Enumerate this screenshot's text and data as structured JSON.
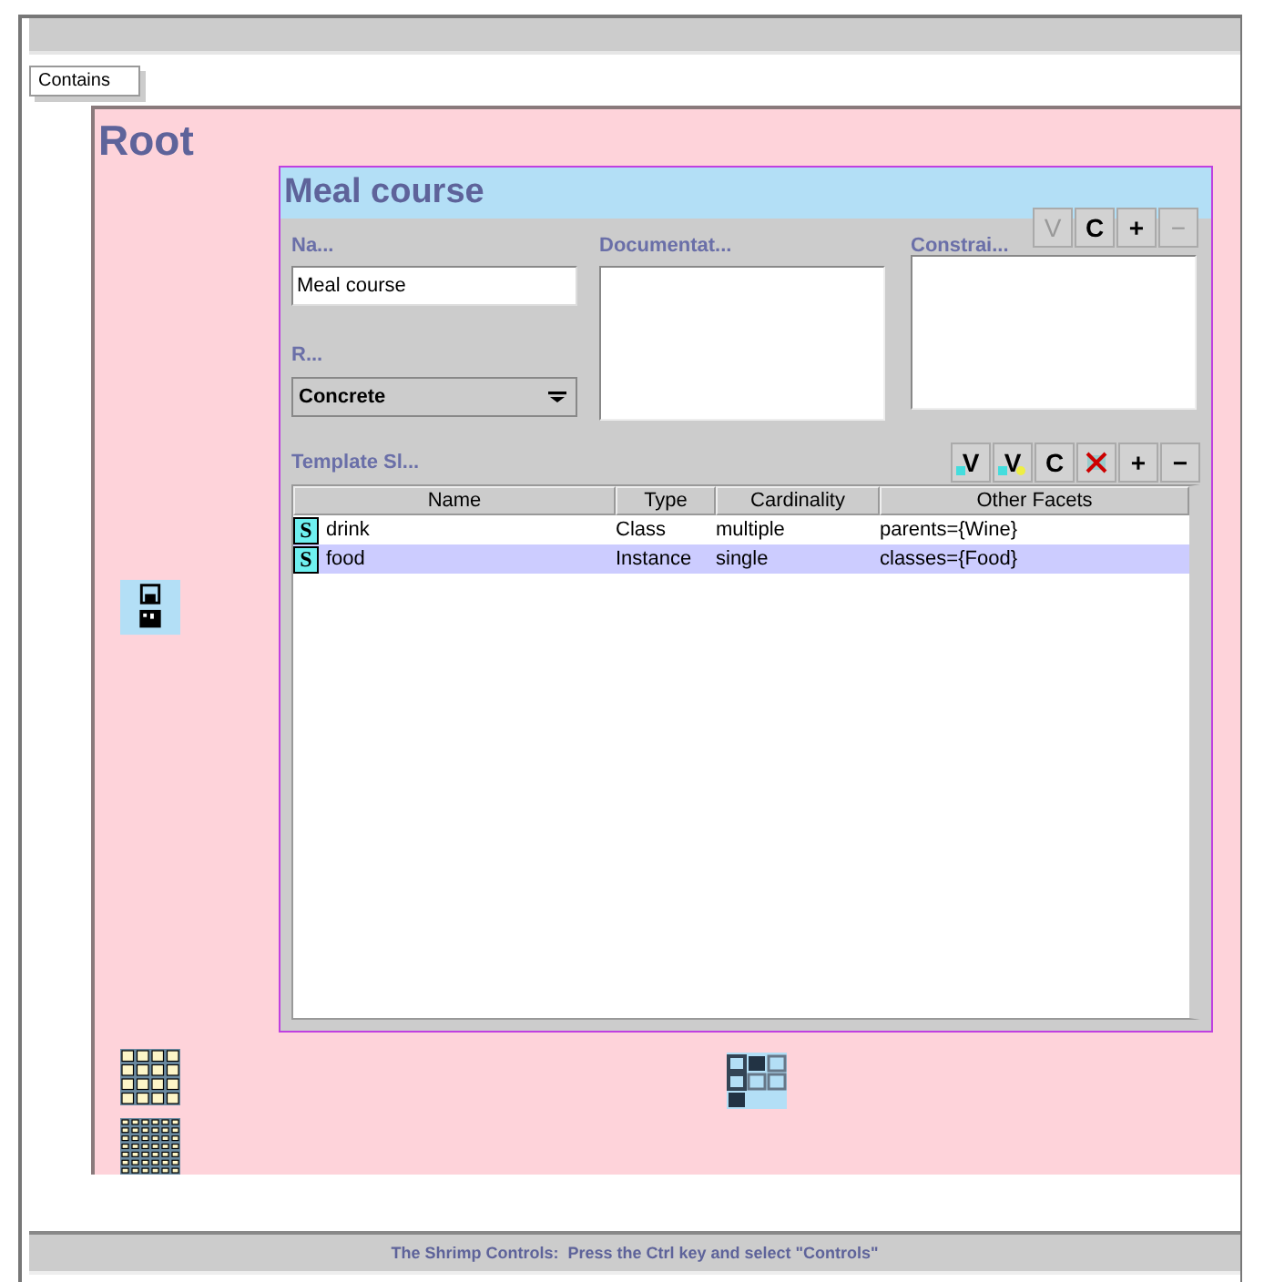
{
  "contains_tab": {
    "label": "Contains"
  },
  "root": {
    "title": "Root"
  },
  "panel": {
    "title": "Meal course",
    "name_label": "Na...",
    "name_value": "Meal course",
    "role_label": "R...",
    "role_value": "Concrete",
    "documentation_label": "Documentat...",
    "constraints_label": "Constrai...",
    "constraint_buttons": [
      {
        "kind": "text",
        "label": "V",
        "disabled": true
      },
      {
        "kind": "text",
        "label": "C",
        "disabled": false
      },
      {
        "kind": "text",
        "label": "+",
        "disabled": false
      },
      {
        "kind": "text",
        "label": "−",
        "disabled": true
      }
    ],
    "slots_label": "Template Sl...",
    "slot_buttons": [
      {
        "kind": "view",
        "label": "V",
        "disabled": false
      },
      {
        "kind": "view-dot",
        "label": "V",
        "disabled": false
      },
      {
        "kind": "text",
        "label": "C",
        "disabled": false
      },
      {
        "kind": "remove",
        "disabled": false
      },
      {
        "kind": "text",
        "label": "+",
        "disabled": false
      },
      {
        "kind": "text",
        "label": "−",
        "disabled": false
      }
    ],
    "columns": [
      "Name",
      "Type",
      "Cardinality",
      "Other Facets"
    ],
    "rows": [
      {
        "badge": "S",
        "name": "drink",
        "type": "Class",
        "cardinality": "multiple",
        "facets": "parents={Wine}",
        "selected": false
      },
      {
        "badge": "S",
        "name": "food",
        "type": "Instance",
        "cardinality": "single",
        "facets": "classes={Food}",
        "selected": true
      }
    ]
  },
  "status_bar": {
    "text": "The Shrimp Controls:  Press the Ctrl key and select \"Controls\""
  }
}
